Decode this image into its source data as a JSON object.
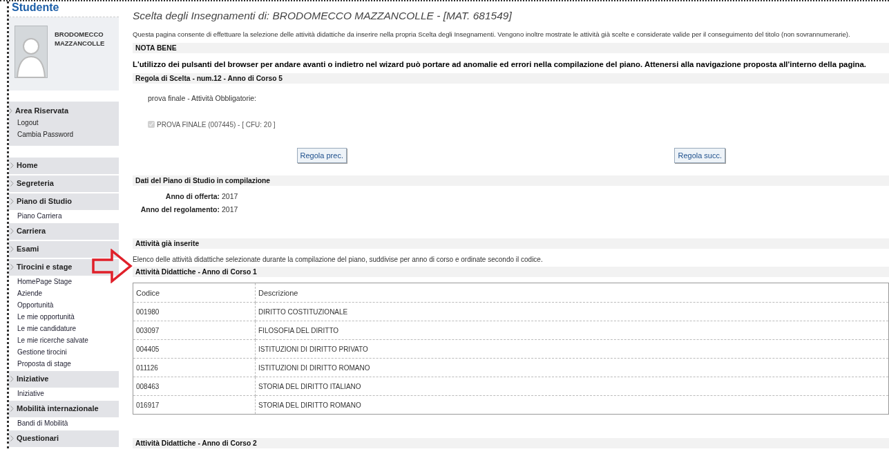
{
  "sidebar": {
    "title": "Studente",
    "user_name": "BRODOMECCO MAZZANCOLLE",
    "area": {
      "label": "Area Riservata",
      "links": [
        "Logout",
        "Cambia Password"
      ]
    },
    "menu": [
      {
        "label": "Home"
      },
      {
        "label": "Segreteria"
      },
      {
        "label": "Piano di Studio",
        "children": [
          "Piano Carriera"
        ]
      },
      {
        "label": "Carriera"
      },
      {
        "label": "Esami"
      },
      {
        "label": "Tirocini e stage",
        "children": [
          "HomePage Stage",
          "Aziende",
          "Opportunità",
          "Le mie opportunità",
          "Le mie candidature",
          "Le mie ricerche salvate",
          "Gestione tirocini",
          "Proposta di stage"
        ]
      },
      {
        "label": "Iniziative",
        "children": [
          "Iniziative"
        ]
      },
      {
        "label": "Mobilità internazionale",
        "children": [
          "Bandi di Mobilità"
        ]
      },
      {
        "label": "Questionari"
      }
    ]
  },
  "main": {
    "title": "Scelta degli Insegnamenti di: BRODOMECCO MAZZANCOLLE - [MAT. 681549]",
    "intro": "Questa pagina consente di effettuare la selezione delle attività didattiche da inserire nella propria Scelta degli Insegnamenti. Vengono inoltre mostrate le attività già scelte e considerate valide per il conseguimento del titolo (non sovrannumerarie).",
    "note_header": "NOTA BENE",
    "warning": "L'utilizzo dei pulsanti del browser per andare avanti o indietro nel wizard può portare ad anomalie ed errori nella compilazione del piano. Attenersi alla navigazione proposta all'interno della pagina.",
    "rule": {
      "header": "Regola di Scelta - num.12 - Anno di Corso 5",
      "group": "prova finale - Attività Obbligatorie:",
      "activities": [
        {
          "label": "PROVA FINALE (007445) - [ CFU: 20 ]",
          "checked": true,
          "disabled": true
        }
      ]
    },
    "buttons": [
      "Regola prec.",
      "Regola succ."
    ],
    "plan": {
      "header": "Dati del Piano di Studio in compilazione",
      "fields": [
        {
          "label": "Anno di offerta:",
          "value": "2017"
        },
        {
          "label": "Anno del regolamento:",
          "value": "2017"
        }
      ]
    },
    "inserted": {
      "header": "Attività già inserite",
      "description": "Elenco delle attività didattiche selezionate durante la compilazione del piano, suddivise per anno di corso e ordinate secondo il codice.",
      "years": [
        {
          "header": "Attività Didattiche - Anno di Corso 1",
          "columns": [
            "Codice",
            "Descrizione"
          ],
          "rows": [
            [
              "001980",
              "DIRITTO COSTITUZIONALE"
            ],
            [
              "003097",
              "FILOSOFIA DEL DIRITTO"
            ],
            [
              "004405",
              "ISTITUZIONI DI DIRITTO PRIVATO"
            ],
            [
              "011126",
              "ISTITUZIONI DI DIRITTO ROMANO"
            ],
            [
              "008463",
              "STORIA DEL DIRITTO ITALIANO"
            ],
            [
              "016917",
              "STORIA DEL DIRITTO ROMANO"
            ]
          ]
        },
        {
          "header": "Attività Didattiche - Anno di Corso 2"
        }
      ]
    }
  }
}
